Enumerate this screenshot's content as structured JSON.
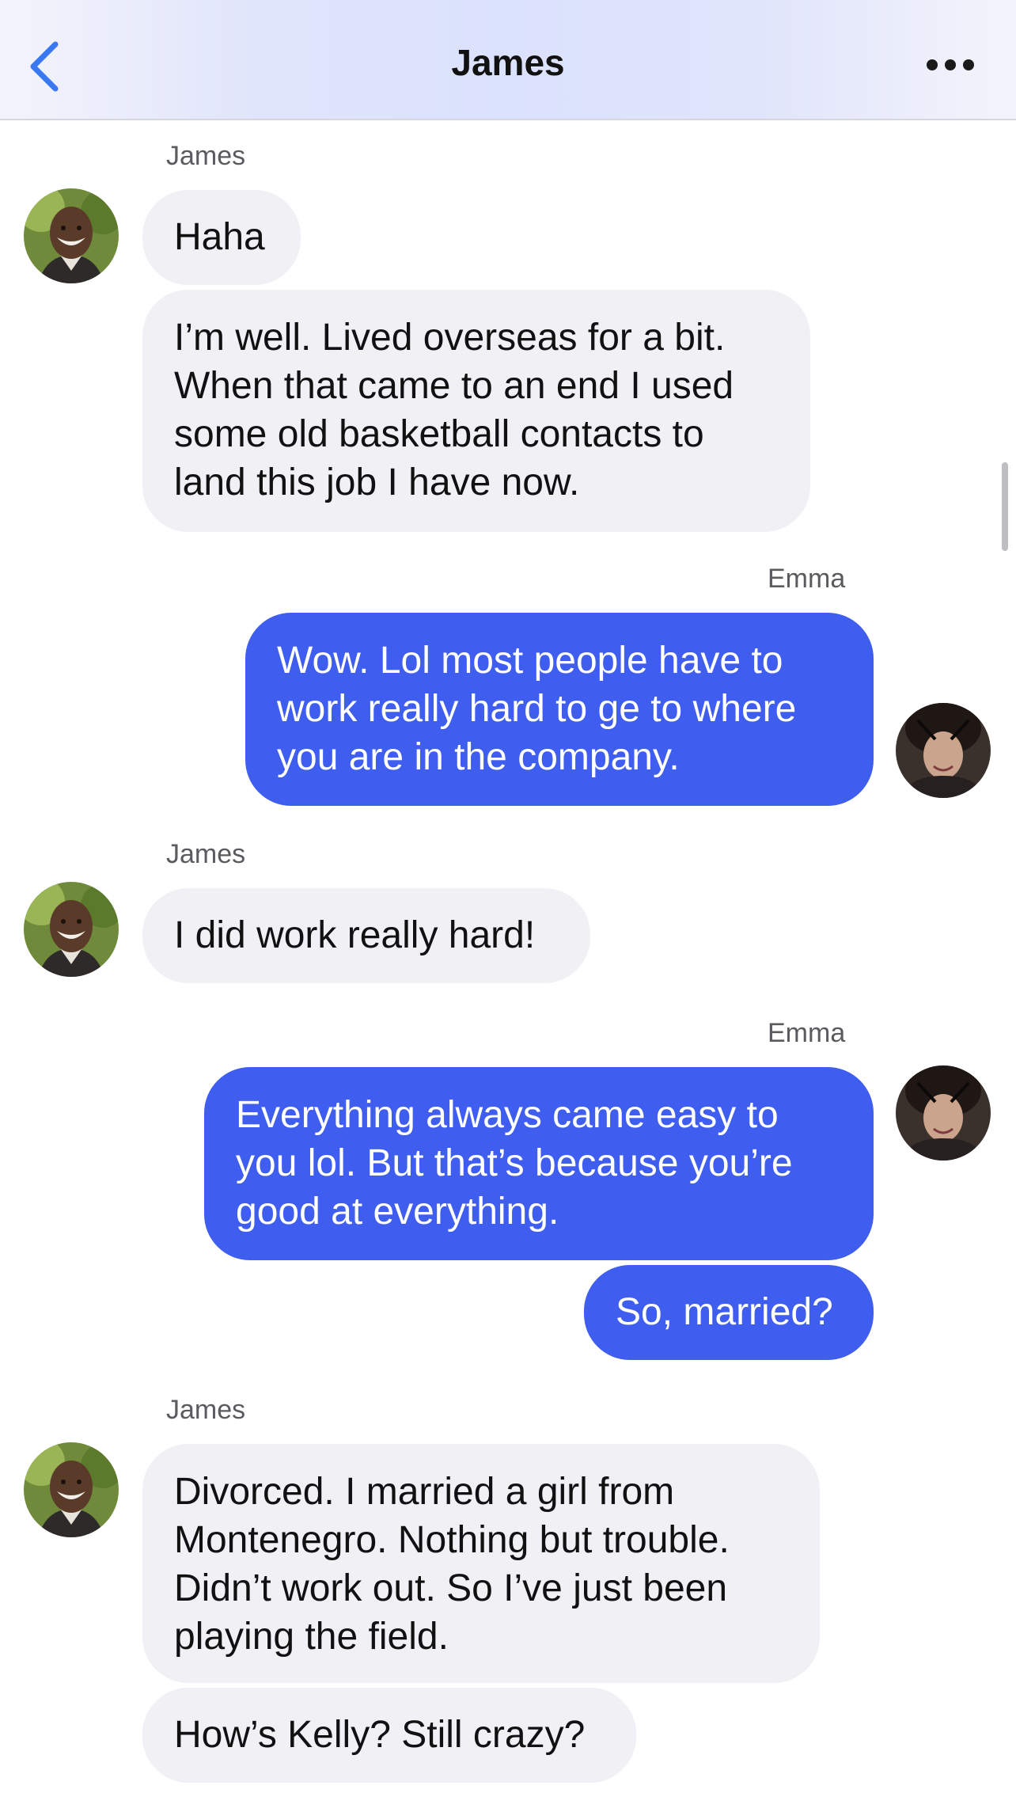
{
  "header": {
    "title": "James",
    "back_icon": "chevron-left-icon",
    "more_icon": "ellipsis-icon",
    "accent": "#3a78f2"
  },
  "colors": {
    "incoming_bubble": "#f1f1f5",
    "outgoing_bubble": "#3f5ef0"
  },
  "messages": [
    {
      "sender": "James",
      "direction": "incoming",
      "name_label": "James",
      "bubbles": [
        {
          "lines": [
            "Haha"
          ]
        },
        {
          "lines": [
            "I’m well. Lived overseas for a bit.",
            "When that came to an end I used",
            "some old basketball contacts to",
            "land this job I have now."
          ]
        }
      ]
    },
    {
      "sender": "Emma",
      "direction": "outgoing",
      "name_label": "Emma",
      "bubbles": [
        {
          "lines": [
            "Wow. Lol most people have to",
            "work really hard to ge to where",
            "you are in the company."
          ]
        }
      ]
    },
    {
      "sender": "James",
      "direction": "incoming",
      "name_label": "James",
      "bubbles": [
        {
          "lines": [
            "I did work really hard!"
          ]
        }
      ]
    },
    {
      "sender": "Emma",
      "direction": "outgoing",
      "name_label": "Emma",
      "bubbles": [
        {
          "lines": [
            "Everything always came easy to",
            "you lol. But that’s because you’re",
            "good at everything."
          ]
        },
        {
          "lines": [
            "So, married?"
          ]
        }
      ]
    },
    {
      "sender": "James",
      "direction": "incoming",
      "name_label": "James",
      "bubbles": [
        {
          "lines": [
            "Divorced. I married a girl from",
            "Montenegro. Nothing but trouble.",
            "Didn’t work out. So I’ve just been",
            "playing the field."
          ]
        },
        {
          "lines": [
            "How’s Kelly? Still crazy?"
          ]
        }
      ]
    }
  ]
}
